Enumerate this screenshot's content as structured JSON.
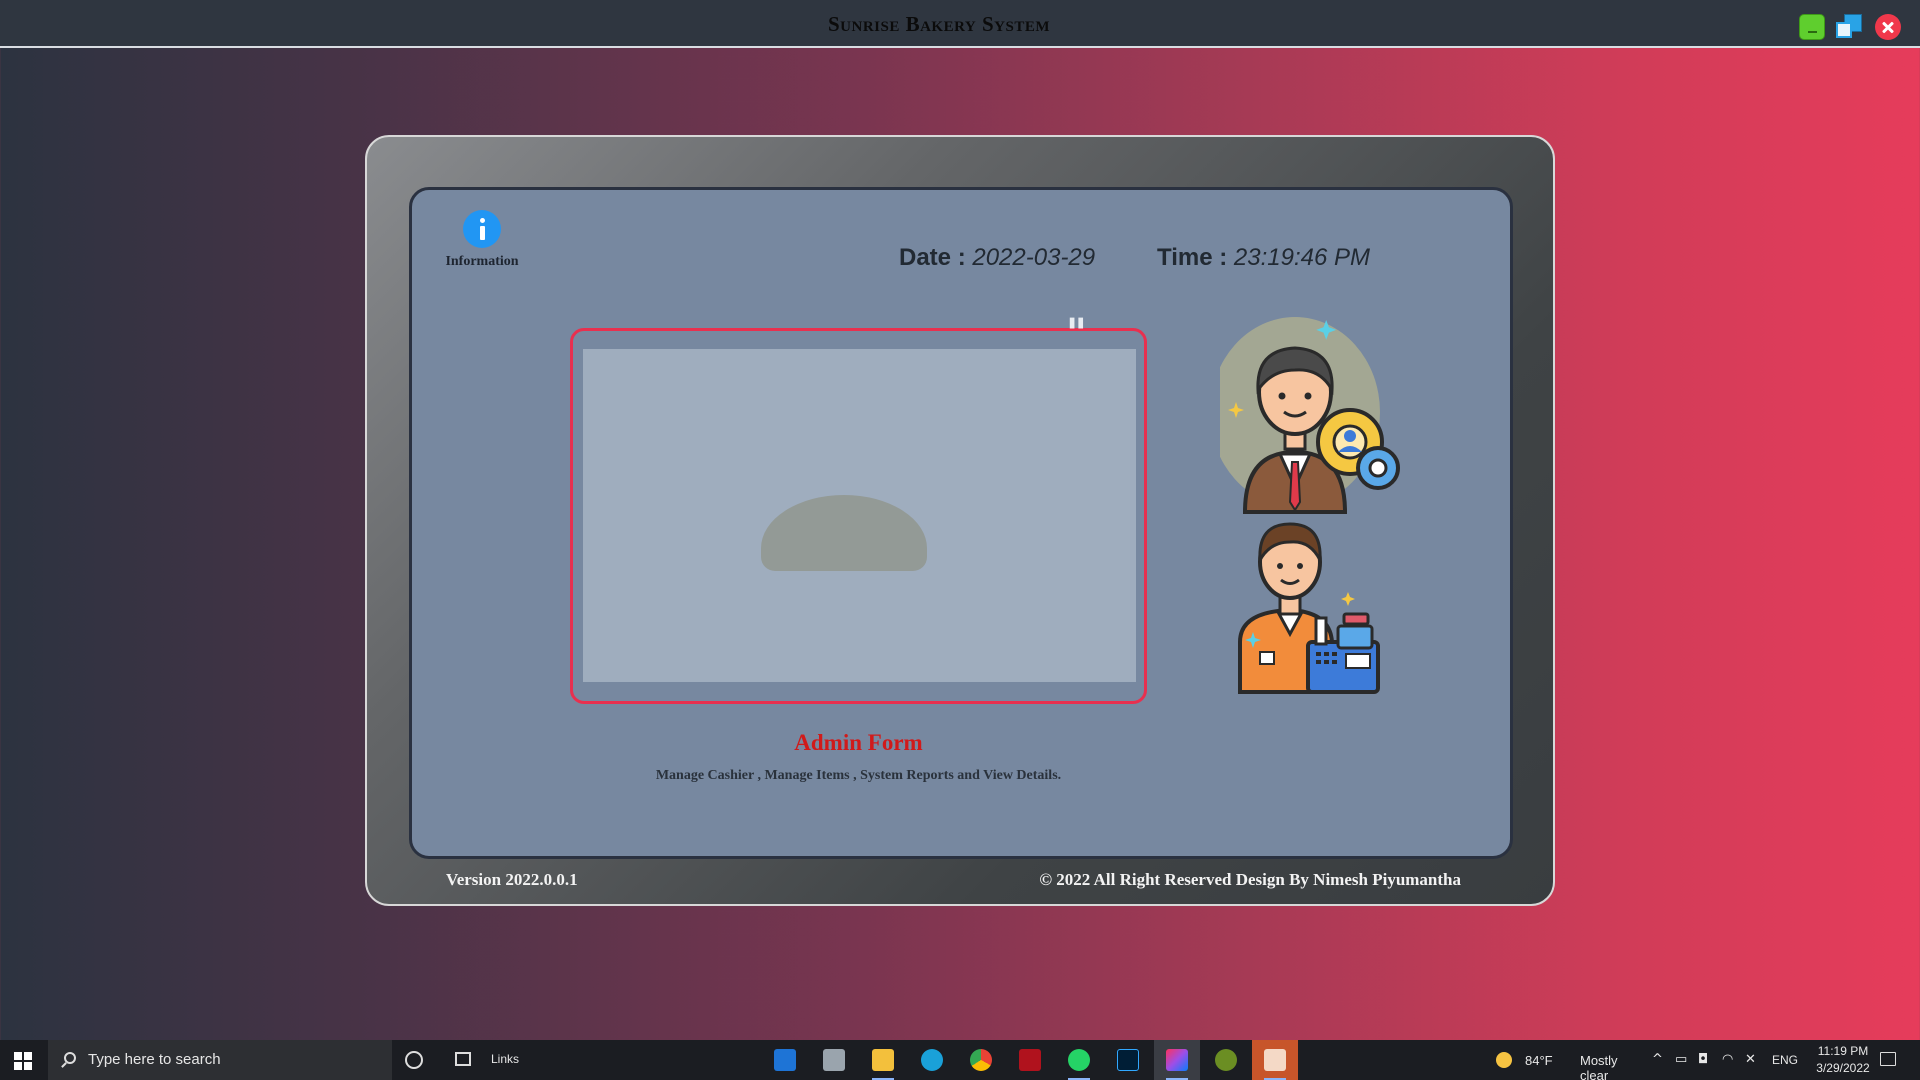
{
  "window": {
    "title": "Sunrise Bakery System"
  },
  "header": {
    "date_label": "Date :",
    "date_value": "2022-03-29",
    "time_label": "Time :",
    "time_value": "23:19:46 PM"
  },
  "info": {
    "label": "Information"
  },
  "card": {
    "quote": "\"",
    "title": "Admin Form",
    "description": "Manage Cashier , Manage Items , System Reports and View Details."
  },
  "footer": {
    "version": "Version 2022.0.0.1",
    "copyright": "© 2022  All Right Reserved Design By Nimesh Piyumantha"
  },
  "taskbar": {
    "search_placeholder": "Type here to search",
    "links_label": "Links",
    "weather_temp": "84°F",
    "weather_condition": "Mostly clear",
    "language": "ENG",
    "clock_time": "11:19 PM",
    "clock_date": "3/29/2022",
    "pinned_apps": [
      "mail-icon",
      "file-manager-icon",
      "folder-icon",
      "edge-icon",
      "chrome-icon",
      "app-red-icon",
      "whatsapp-icon",
      "photoshop-icon",
      "intellij-icon",
      "app-green-icon",
      "java-icon"
    ]
  },
  "colors": {
    "card_border": "#e8304f",
    "card_title": "#d11a1a",
    "info_icon": "#2196f3",
    "minimize": "#5fce2e",
    "maximize": "#29a3e6",
    "close": "#f0384b"
  }
}
